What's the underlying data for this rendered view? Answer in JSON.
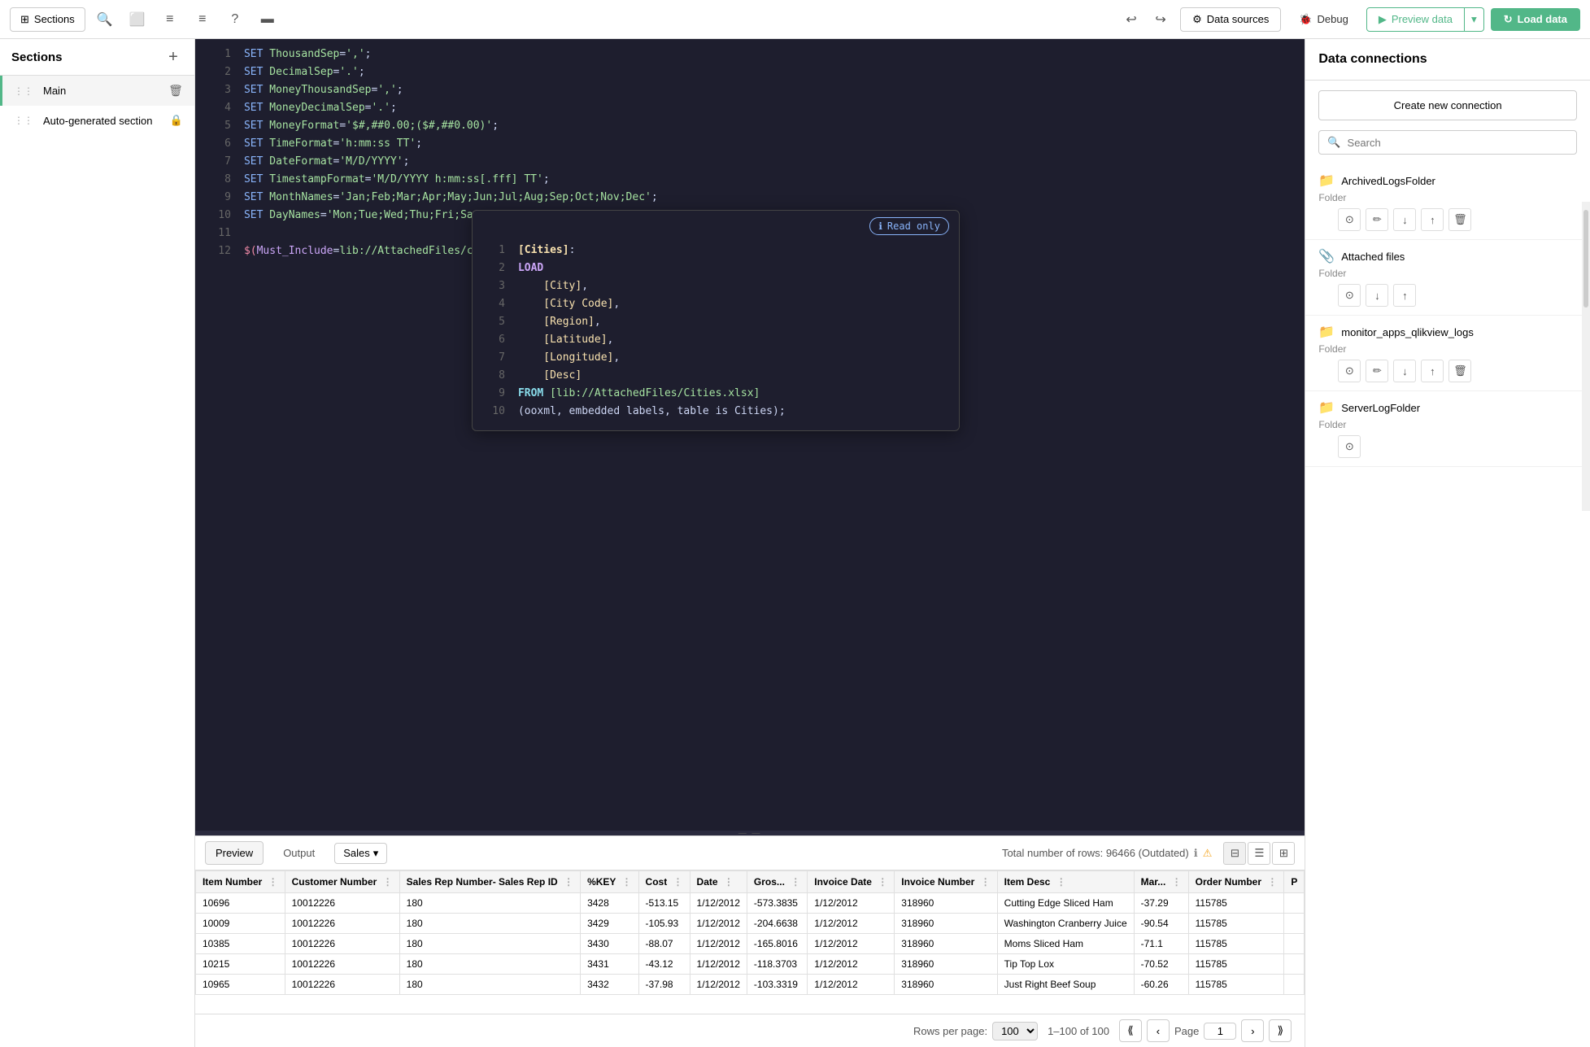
{
  "toolbar": {
    "sections_btn": "Sections",
    "data_sources_btn": "Data sources",
    "debug_btn": "Debug",
    "preview_data_btn": "Preview data",
    "load_data_btn": "Load data"
  },
  "sidebar": {
    "title": "Sections",
    "add_btn": "+",
    "items": [
      {
        "label": "Main",
        "active": true,
        "draggable": true
      },
      {
        "label": "Auto-generated section",
        "active": false,
        "locked": true,
        "draggable": true
      }
    ]
  },
  "editor": {
    "lines": [
      {
        "num": 1,
        "content": "SET ThousandSep=',';",
        "type": "set"
      },
      {
        "num": 2,
        "content": "SET DecimalSep='.';",
        "type": "set"
      },
      {
        "num": 3,
        "content": "SET MoneyThousandSep=',';",
        "type": "set"
      },
      {
        "num": 4,
        "content": "SET MoneyDecimalSep='.';",
        "type": "set"
      },
      {
        "num": 5,
        "content": "SET MoneyFormat='$#,##0.00;($#,##0.00)';",
        "type": "set"
      },
      {
        "num": 6,
        "content": "SET TimeFormat='h:mm:ss TT';",
        "type": "set"
      },
      {
        "num": 7,
        "content": "SET DateFormat='M/D/YYYY';",
        "type": "set"
      },
      {
        "num": 8,
        "content": "SET TimestampFormat='M/D/YYYY h:mm:ss[.fff] TT';",
        "type": "set"
      },
      {
        "num": 9,
        "content": "SET MonthNames='Jan;Feb;Mar;Apr;May;Jun;Jul;Aug;Sep;Oct;Nov;Dec';",
        "type": "set"
      },
      {
        "num": 10,
        "content": "SET DayNames='Mon;Tue;Wed;Thu;Fri;Sat;Sun';",
        "type": "set"
      },
      {
        "num": 11,
        "content": "",
        "type": "empty"
      },
      {
        "num": 12,
        "content": "$(Must_Include=lib://AttachedFiles/cities.txt)",
        "type": "include"
      }
    ],
    "popup": {
      "read_only_label": "Read only",
      "lines": [
        {
          "num": 1,
          "content": "[Cities]:"
        },
        {
          "num": 2,
          "content": "LOAD"
        },
        {
          "num": 3,
          "content": "    [City],"
        },
        {
          "num": 4,
          "content": "    [City Code],"
        },
        {
          "num": 5,
          "content": "    [Region],"
        },
        {
          "num": 6,
          "content": "    [Latitude],"
        },
        {
          "num": 7,
          "content": "    [Longitude],"
        },
        {
          "num": 8,
          "content": "    [Desc]"
        },
        {
          "num": 9,
          "content": "FROM [lib://AttachedFiles/Cities.xlsx]"
        },
        {
          "num": 10,
          "content": "(ooxml, embedded labels, table is Cities);"
        }
      ]
    }
  },
  "bottom_panel": {
    "preview_tab": "Preview",
    "output_tab": "Output",
    "sales_label": "Sales",
    "row_count": "Total number of rows: 96466 (Outdated)",
    "table": {
      "columns": [
        "Item Number",
        "Customer Number",
        "Sales Rep Number- Sales Rep ID",
        "%KEY",
        "Cost",
        "Date",
        "Gros...",
        "Invoice Date",
        "Invoice Number",
        "Item Desc",
        "Mar...",
        "Order Number",
        "P"
      ],
      "rows": [
        [
          10696,
          10012226,
          180,
          3428,
          -513.15,
          "1/12/2012",
          -573.3835,
          "1/12/2012",
          318960,
          "Cutting Edge Sliced Ham",
          -37.29,
          115785,
          ""
        ],
        [
          10009,
          10012226,
          180,
          3429,
          -105.93,
          "1/12/2012",
          -204.6638,
          "1/12/2012",
          318960,
          "Washington Cranberry Juice",
          -90.54,
          115785,
          ""
        ],
        [
          10385,
          10012226,
          180,
          3430,
          -88.07,
          "1/12/2012",
          -165.8016,
          "1/12/2012",
          318960,
          "Moms Sliced Ham",
          -71.1,
          115785,
          ""
        ],
        [
          10215,
          10012226,
          180,
          3431,
          -43.12,
          "1/12/2012",
          -118.3703,
          "1/12/2012",
          318960,
          "Tip Top Lox",
          -70.52,
          115785,
          ""
        ],
        [
          10965,
          10012226,
          180,
          3432,
          -37.98,
          "1/12/2012",
          -103.3319,
          "1/12/2012",
          318960,
          "Just Right Beef Soup",
          -60.26,
          115785,
          ""
        ]
      ]
    },
    "pagination": {
      "rows_per_page_label": "Rows per page:",
      "rows_per_page_value": "100",
      "page_label": "Page",
      "current_page": "1",
      "range": "1–100 of 100"
    }
  },
  "right_panel": {
    "title": "Data connections",
    "create_connection_btn": "Create new connection",
    "search_placeholder": "Search",
    "connections": [
      {
        "name": "ArchivedLogsFolder",
        "type": "Folder",
        "actions": [
          "select",
          "edit",
          "insert_load",
          "insert_store",
          "delete"
        ]
      },
      {
        "name": "Attached files",
        "type": "Folder",
        "actions": [
          "select",
          "insert_load",
          "insert_store"
        ]
      },
      {
        "name": "monitor_apps_qlikview_logs",
        "type": "Folder",
        "actions": [
          "select",
          "edit",
          "insert_load",
          "insert_store",
          "delete"
        ]
      },
      {
        "name": "ServerLogFolder",
        "type": "Folder",
        "actions": [
          "select"
        ]
      }
    ]
  }
}
